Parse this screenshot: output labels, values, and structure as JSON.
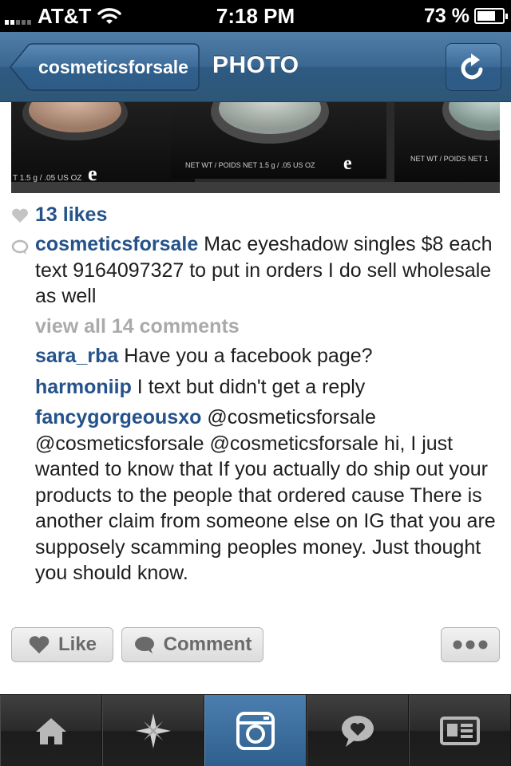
{
  "status_bar": {
    "carrier": "AT&T",
    "time": "7:18 PM",
    "battery": "73 %",
    "battery_level": 0.73,
    "icons": [
      "signal-icon",
      "wifi-icon",
      "battery-icon"
    ]
  },
  "nav": {
    "back_label": "cosmeticsforsale",
    "title": "PHOTO",
    "refresh_icon": "refresh-icon"
  },
  "photo": {
    "labels": [
      "T 1.5 g / .05 US OZ",
      "NET WT / POIDS NET 1.5 g / .05 US OZ",
      "NET WT / POIDS NET 1"
    ]
  },
  "post": {
    "likes": "13 likes",
    "caption_user": "cosmeticsforsale",
    "caption_text": "Mac eyeshadow singles $8 each text 9164097327 to put in orders I do sell wholesale as well",
    "view_all": "view all 14 comments",
    "comments": [
      {
        "user": "sara_rba",
        "text": "Have you a facebook page?"
      },
      {
        "user": "harmoniip",
        "text": "I text but didn't get a reply"
      },
      {
        "user": "fancygorgeousxo",
        "text": "@cosmeticsforsale @cosmeticsforsale @cosmeticsforsale hi, I just wanted to know that If you actually do ship out your products to the people that ordered cause There is another claim from someone else on IG that you are supposely scamming peoples money. Just thought you should know."
      }
    ]
  },
  "actions": {
    "like_label": "Like",
    "comment_label": "Comment"
  },
  "tabbar": {
    "tabs": [
      "home-icon",
      "explore-icon",
      "camera-icon",
      "news-icon",
      "profile-icon"
    ],
    "active": "camera-icon"
  },
  "colors": {
    "nav_blue": "#3a6790",
    "username_blue": "#245289",
    "muted_gray": "#aaaaaa"
  }
}
